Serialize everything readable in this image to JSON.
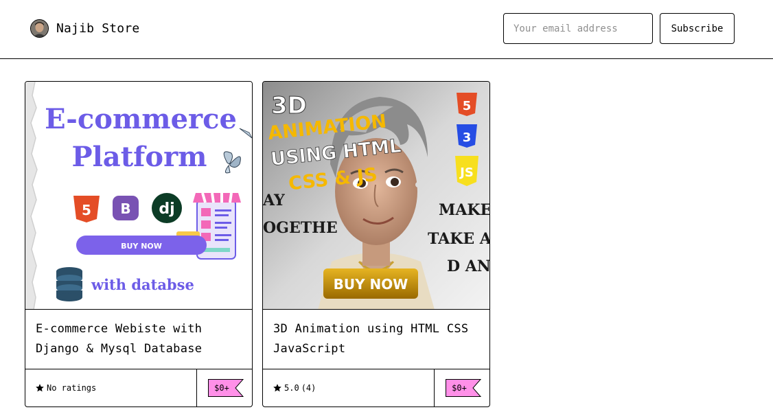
{
  "header": {
    "store_name": "Najib Store",
    "email_placeholder": "Your email address",
    "subscribe_label": "Subscribe"
  },
  "products": [
    {
      "title": "E-commerce Webiste with Django & Mysql Database",
      "rating_text": "No ratings",
      "price": "$0+",
      "thumbnail": {
        "headline_1": "E-commerce",
        "headline_2": "Platform",
        "logo_bootstrap": "B",
        "logo_django": "dj",
        "button_text": "BUY NOW",
        "footer_text": "with databse"
      }
    },
    {
      "title": "3D Animation using HTML CSS JavaScript",
      "rating_text": "5.0",
      "rating_count": "(4)",
      "price": "$0+",
      "thumbnail": {
        "line_1": "3D",
        "line_2": "ANIMATION",
        "line_3": "USING HTML",
        "line_4": "CSS & JS",
        "bg_text_1": "AY",
        "bg_text_2": "OGETHE",
        "bg_text_3": "MAKE",
        "bg_text_4": "TAKE A",
        "bg_text_5": "D AN",
        "button_text": "BUY NOW",
        "badge_html": "5",
        "badge_css": "3",
        "badge_js": "JS"
      }
    }
  ],
  "colors": {
    "price_tag": "#ff90e8",
    "ecommerce_purple": "#6c5ce7",
    "animation_yellow": "#f5b800"
  }
}
